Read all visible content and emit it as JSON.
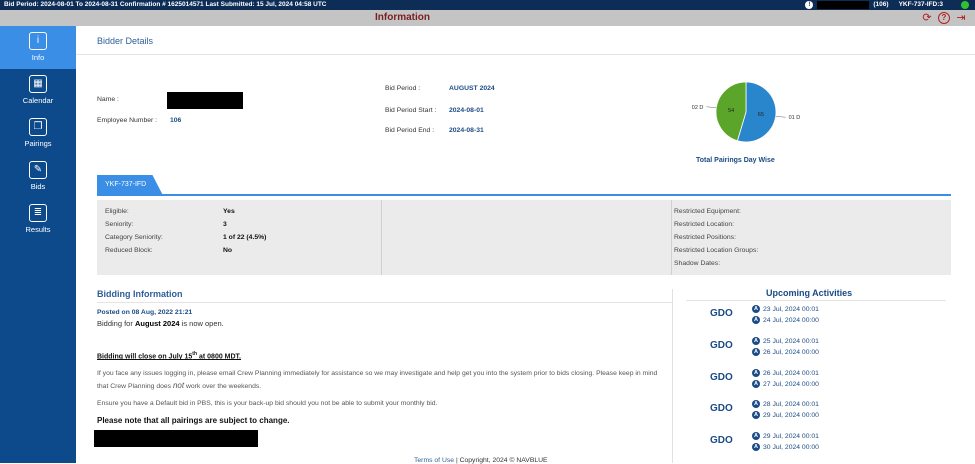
{
  "topbar": {
    "info": "Bid Period: 2024-08-01 To 2024-08-31 Confirmation # 1625014571 Last Submitted: 15 Jul, 2024 04:58 UTC",
    "count": "(106)",
    "crew": "YKF-737-IFD:3"
  },
  "titlebar": {
    "title": "Information"
  },
  "sidebar": {
    "items": [
      {
        "label": "Info",
        "icon": "info-icon"
      },
      {
        "label": "Calendar",
        "icon": "calendar-icon"
      },
      {
        "label": "Pairings",
        "icon": "pairings-icon"
      },
      {
        "label": "Bids",
        "icon": "bids-icon"
      },
      {
        "label": "Results",
        "icon": "results-icon"
      }
    ]
  },
  "bidder": {
    "heading": "Bidder Details",
    "name_label": "Name :",
    "employee_label": "Employee Number :",
    "employee_value": "106",
    "bid_period_label": "Bid Period :",
    "bid_period_value": "AUGUST 2024",
    "start_label": "Bid Period Start :",
    "start_value": "2024-08-01",
    "end_label": "Bid Period End :",
    "end_value": "2024-08-31"
  },
  "pie": {
    "title": "Total Pairings Day Wise",
    "slices": [
      {
        "label": "01 D",
        "value": 65,
        "color": "#2a86cc"
      },
      {
        "label": "02 D",
        "value": 54,
        "color": "#5aa52a"
      }
    ]
  },
  "tab": {
    "label": "YKF-737-IFD"
  },
  "eligibility": {
    "labels": [
      "Eligible:",
      "Seniority:",
      "Category Seniority:",
      "Reduced Block:"
    ],
    "values": [
      "Yes",
      "3",
      "1 of 22 (4.5%)",
      "No"
    ],
    "restrictions": [
      "Restricted Equipment:",
      "Restricted Location:",
      "Restricted Positions:",
      "Restricted Location Groups:",
      "Shadow Dates:"
    ]
  },
  "bidding": {
    "title": "Bidding Information",
    "posted": "Posted on 08 Aug, 2022 21:21",
    "open_prefix": "Bidding for",
    "open_month": "August 2024",
    "open_suffix": "is now open.",
    "closing_a": "Bidding will close on July 15",
    "closing_sup": "th",
    "closing_b": "at 0800 MDT.",
    "para1": "If you face any issues logging in, please email Crew Planning immediately for assistance so we may investigate and help get you into the system prior to bids closing. Please keep in mind that Crew Planning does",
    "para1_em": "not",
    "para1_end": "work over the weekends.",
    "para2": "Ensure you have a Default bid in PBS, this is your back-up bid should you not be able to submit your monthly bid.",
    "note": "Please note that all pairings are subject to change."
  },
  "upcoming": {
    "title": "Upcoming Activities",
    "items": [
      {
        "code": "GDO",
        "from": "23 Jul, 2024 00:01",
        "to": "24 Jul, 2024 00:00"
      },
      {
        "code": "GDO",
        "from": "25 Jul, 2024 00:01",
        "to": "26 Jul, 2024 00:00"
      },
      {
        "code": "GDO",
        "from": "26 Jul, 2024 00:01",
        "to": "27 Jul, 2024 00:00"
      },
      {
        "code": "GDO",
        "from": "28 Jul, 2024 00:01",
        "to": "29 Jul, 2024 00:00"
      },
      {
        "code": "GDO",
        "from": "29 Jul, 2024 00:01",
        "to": "30 Jul, 2024 00:00"
      }
    ],
    "badge": "A"
  },
  "footer": {
    "terms": "Terms of Use",
    "copyright": "| Copyright, 2024 © NAVBLUE"
  }
}
